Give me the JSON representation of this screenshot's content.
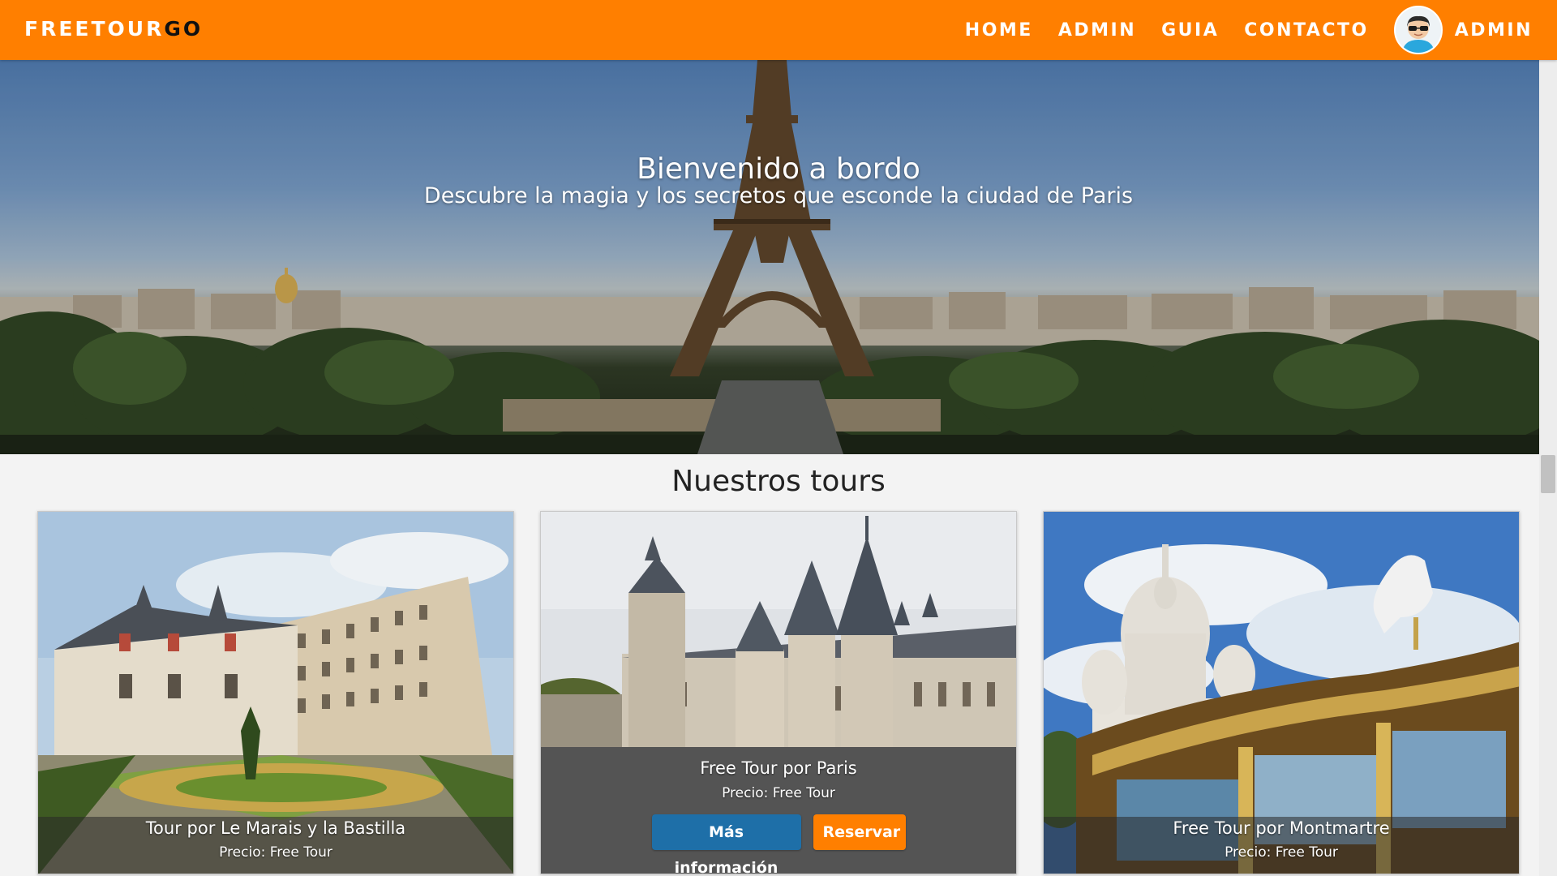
{
  "navbar": {
    "brand_a": "FREETOUR",
    "brand_b": "GO",
    "links": [
      "HOME",
      "ADMIN",
      "GUIA",
      "CONTACTO"
    ],
    "user_label": "ADMIN",
    "color": "#ff7f00"
  },
  "hero": {
    "title": "Bienvenido a bordo",
    "subtitle": "Descubre la magia y los secretos que esconde la ciudad de Paris"
  },
  "tours": {
    "heading": "Nuestros tours",
    "cards": [
      {
        "title": "Tour por Le Marais y la Bastilla",
        "price": "Precio: Free Tour"
      },
      {
        "title": "Free Tour por Paris",
        "price": "Precio: Free Tour",
        "more_label": "Más información",
        "book_label": "Reservar"
      },
      {
        "title": "Free Tour por Montmartre",
        "price": "Precio: Free Tour"
      }
    ]
  },
  "colors": {
    "accent": "#ff7f00",
    "info": "#1e6fa8",
    "panel": "#545454"
  },
  "icons": [
    "user-avatar-icon"
  ]
}
